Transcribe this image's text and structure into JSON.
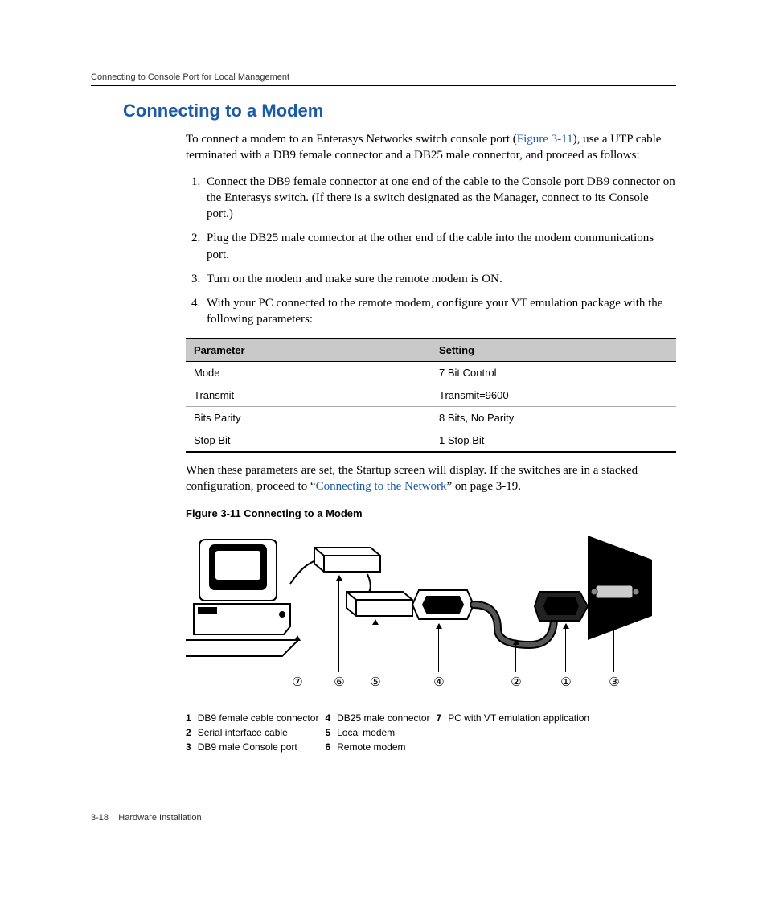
{
  "runningHeader": "Connecting to Console Port for Local Management",
  "sectionTitle": "Connecting to a Modem",
  "intro": {
    "pre": "To connect a modem to an Enterasys Networks switch console port (",
    "link": "Figure 3-11",
    "post": "), use a UTP cable terminated with a DB9 female connector and a DB25 male connector, and proceed as follows:"
  },
  "steps": [
    "Connect the DB9 female connector at one end of the cable to the Console port DB9 connector on the Enterasys switch. (If there is a switch designated as the Manager, connect to its Console port.)",
    "Plug the DB25 male connector at the other end of the cable into the modem communications port.",
    "Turn on the modem and make sure the remote modem is ON.",
    "With your PC connected to the remote modem, configure your VT emulation package with the following parameters:"
  ],
  "table": {
    "headers": [
      "Parameter",
      "Setting"
    ],
    "rows": [
      [
        "Mode",
        "7 Bit Control"
      ],
      [
        "Transmit",
        "Transmit=9600"
      ],
      [
        "Bits Parity",
        "8 Bits, No Parity"
      ],
      [
        "Stop Bit",
        "1 Stop Bit"
      ]
    ]
  },
  "afterTable": {
    "pre": "When these parameters are set, the Startup screen will display. If the switches are in a stacked configuration, proceed to “",
    "link": "Connecting to the Network",
    "post": "” on page 3-19."
  },
  "figureCaption": "Figure 3-11     Connecting to a Modem",
  "markers": [
    "⑦",
    "⑥",
    "⑤",
    "④",
    "②",
    "①",
    "③"
  ],
  "legend": [
    {
      "n": "1",
      "t": "DB9 female cable connector"
    },
    {
      "n": "2",
      "t": "Serial interface cable"
    },
    {
      "n": "3",
      "t": "DB9 male Console port"
    },
    {
      "n": "4",
      "t": "DB25 male connector"
    },
    {
      "n": "5",
      "t": "Local modem"
    },
    {
      "n": "6",
      "t": "Remote modem"
    },
    {
      "n": "7",
      "t": "PC with VT emulation application"
    }
  ],
  "footer": {
    "page": "3-18",
    "title": "Hardware Installation"
  }
}
